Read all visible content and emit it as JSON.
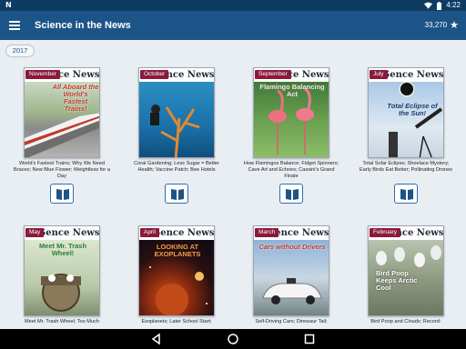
{
  "status_bar": {
    "left_label": "N",
    "time": "4:22",
    "wifi_icon": "wifi-icon",
    "battery_icon": "battery-icon"
  },
  "app_bar": {
    "menu_icon": "menu-icon",
    "title": "Science in the News",
    "count": "33,270",
    "star_icon": "star-icon"
  },
  "year_filter": {
    "label": "2017"
  },
  "issues": [
    {
      "month": "November",
      "masthead": "ence News",
      "headline": "All Aboard the World's Fastest Trains!",
      "caption": "World's Fastest Trains; Why We Need Braces; New Blue Flower; Weightless for a Day",
      "accent": "#c0392b"
    },
    {
      "month": "October",
      "masthead": "ence News",
      "headline": "",
      "caption": "Coral Gardening; Less Sugar = Better Health; Vaccine Patch; Bee Hotels",
      "accent": "#1e6fa8"
    },
    {
      "month": "September",
      "masthead": "ence News",
      "headline": "Flamingo Balancing Act",
      "caption": "How Flamingos Balance; Fidget Spinners; Cave Art and Echoes; Cassini's Grand Finale",
      "accent": "#3a7d3a"
    },
    {
      "month": "July",
      "masthead": "ence News",
      "headline": "Total Eclipse of the Sun!",
      "caption": "Total Solar Eclipse; Shoelace Mystery; Early Birds Eat Better; Pollinating Drones",
      "accent": "#4a90c8"
    },
    {
      "month": "May",
      "masthead": "ence News",
      "headline": "Meet Mr. Trash Wheel!",
      "caption": "Meet Mr. Trash Wheel; Too Much",
      "accent": "#6aa84f"
    },
    {
      "month": "April",
      "masthead": "ence News",
      "headline": "LOOKING AT EXOPLANETS",
      "caption": "Exoplanets; Later School Start;",
      "accent": "#e06020"
    },
    {
      "month": "March",
      "masthead": "ence News",
      "headline": "Cars without Drivers",
      "caption": "Self-Driving Cars; Dinosaur Tail;",
      "accent": "#4a6fa5"
    },
    {
      "month": "February",
      "masthead": "ence News",
      "headline": "Bird Poop Keeps Arctic Cool",
      "caption": "Bird Poop and Clouds; Record-",
      "accent": "#7a8a6a"
    }
  ],
  "read_button_icon": "book-open-icon",
  "nav_bar": {
    "back_icon": "back-triangle-icon",
    "home_icon": "home-circle-icon",
    "recents_icon": "recents-square-icon"
  }
}
